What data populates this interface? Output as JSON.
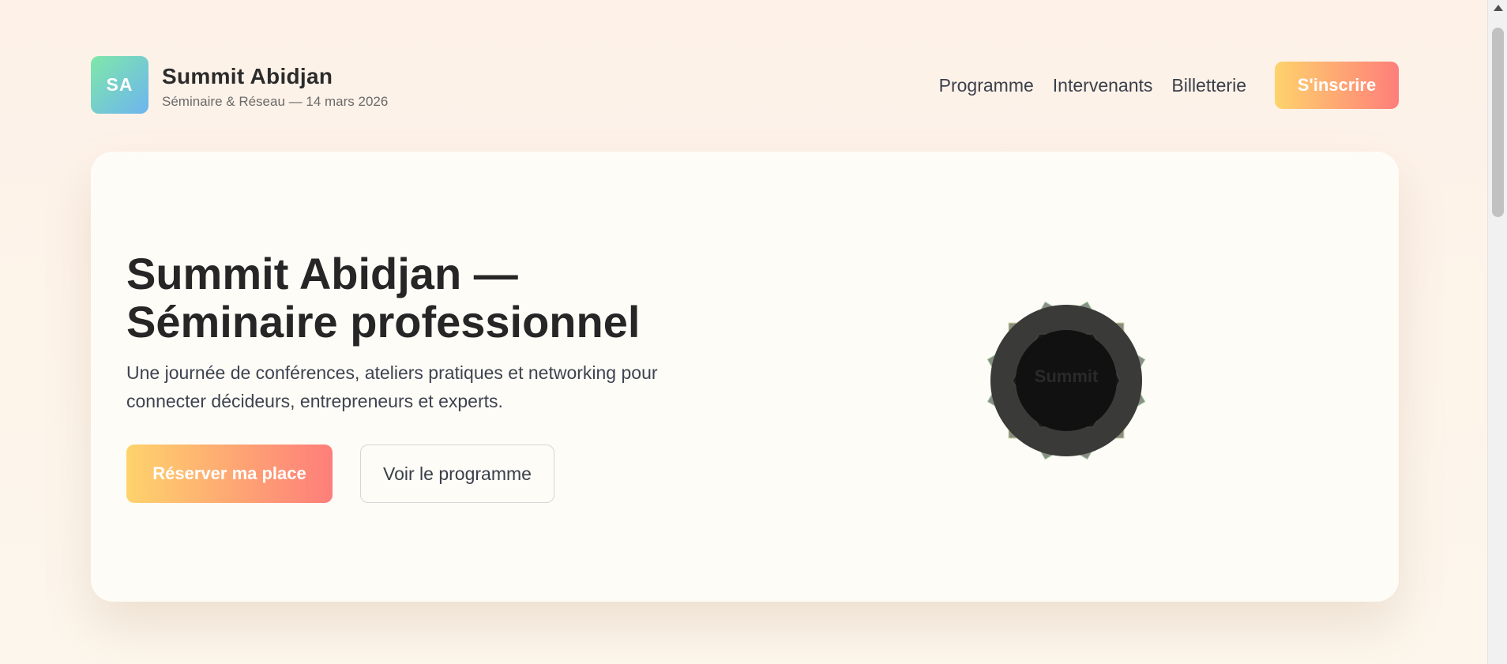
{
  "brand": {
    "logo_initials": "SA",
    "name": "Summit Abidjan",
    "subtitle": "Séminaire & Réseau — 14 mars 2026"
  },
  "nav": {
    "items": [
      {
        "label": "Programme"
      },
      {
        "label": "Intervenants"
      },
      {
        "label": "Billetterie"
      }
    ],
    "cta_label": "S'inscrire"
  },
  "hero": {
    "title_line1": "Summit Abidjan —",
    "title_line2": "Séminaire professionnel",
    "description": "Une journée de conférences, ateliers pratiques et networking pour connecter décideurs, entrepreneurs et experts.",
    "primary_button": "Réserver ma place",
    "secondary_button": "Voir le programme",
    "seal_label": "Summit"
  },
  "colors": {
    "accent_gradient_start": "#fed36c",
    "accent_gradient_end": "#fe7e7a",
    "logo_gradient_start": "#7ee8a8",
    "logo_gradient_end": "#6db4f0"
  },
  "icons": {
    "seal": "star-seal-icon"
  }
}
